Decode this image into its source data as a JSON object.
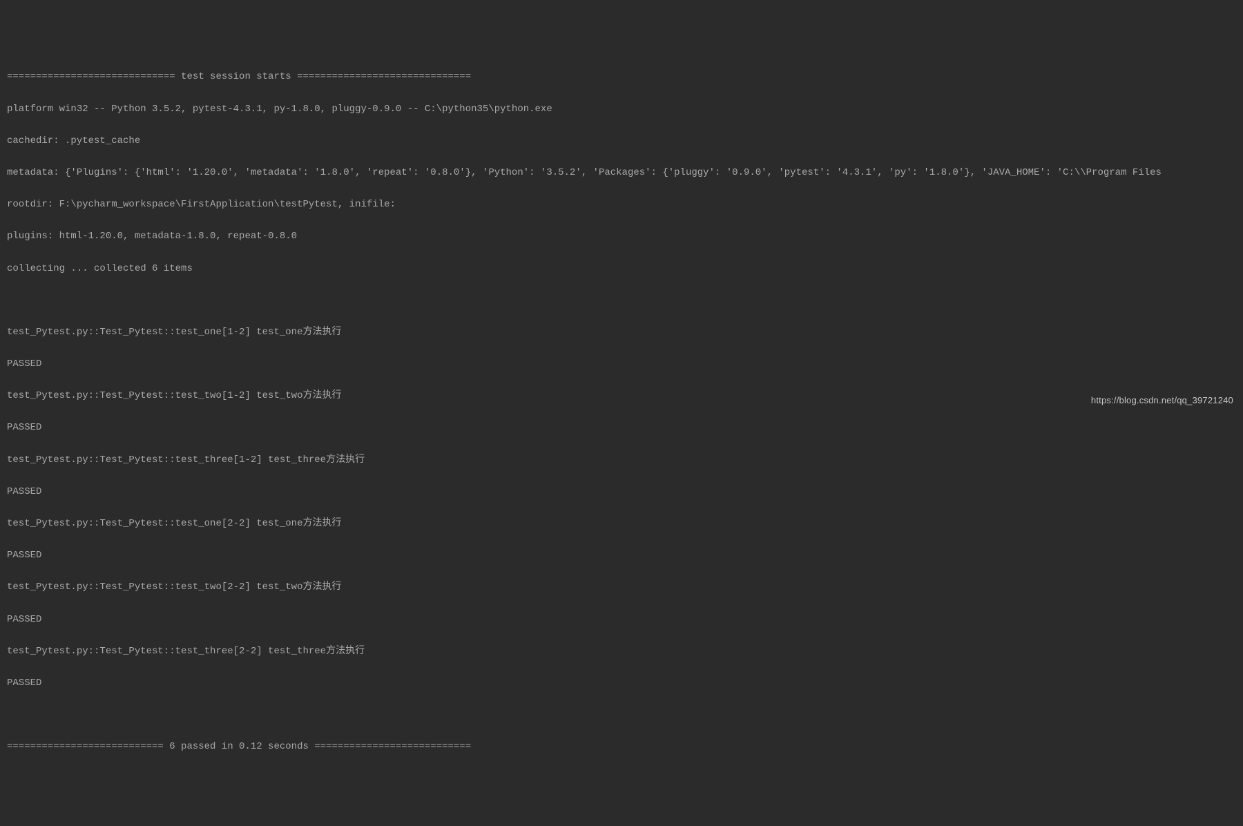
{
  "header": {
    "session_start": "============================= test session starts ==============================",
    "platform": "platform win32 -- Python 3.5.2, pytest-4.3.1, py-1.8.0, pluggy-0.9.0 -- C:\\python35\\python.exe",
    "cachedir": "cachedir: .pytest_cache",
    "metadata": "metadata: {'Plugins': {'html': '1.20.0', 'metadata': '1.8.0', 'repeat': '0.8.0'}, 'Python': '3.5.2', 'Packages': {'pluggy': '0.9.0', 'pytest': '4.3.1', 'py': '1.8.0'}, 'JAVA_HOME': 'C:\\\\Program Files",
    "rootdir": "rootdir: F:\\pycharm_workspace\\FirstApplication\\testPytest, inifile:",
    "plugins": "plugins: html-1.20.0, metadata-1.8.0, repeat-0.8.0",
    "collecting": "collecting ... collected 6 items"
  },
  "tests": [
    {
      "id": "test_Pytest.py::Test_Pytest::test_one[1-2] test_one方法执行",
      "result": "PASSED"
    },
    {
      "id": "test_Pytest.py::Test_Pytest::test_two[1-2] test_two方法执行",
      "result": "PASSED"
    },
    {
      "id": "test_Pytest.py::Test_Pytest::test_three[1-2] test_three方法执行",
      "result": "PASSED"
    },
    {
      "id": "test_Pytest.py::Test_Pytest::test_one[2-2] test_one方法执行",
      "result": "PASSED"
    },
    {
      "id": "test_Pytest.py::Test_Pytest::test_two[2-2] test_two方法执行",
      "result": "PASSED"
    },
    {
      "id": "test_Pytest.py::Test_Pytest::test_three[2-2] test_three方法执行",
      "result": "PASSED"
    }
  ],
  "footer": {
    "summary": "=========================== 6 passed in 0.12 seconds ==========================="
  },
  "watermark": "https://blog.csdn.net/qq_39721240"
}
